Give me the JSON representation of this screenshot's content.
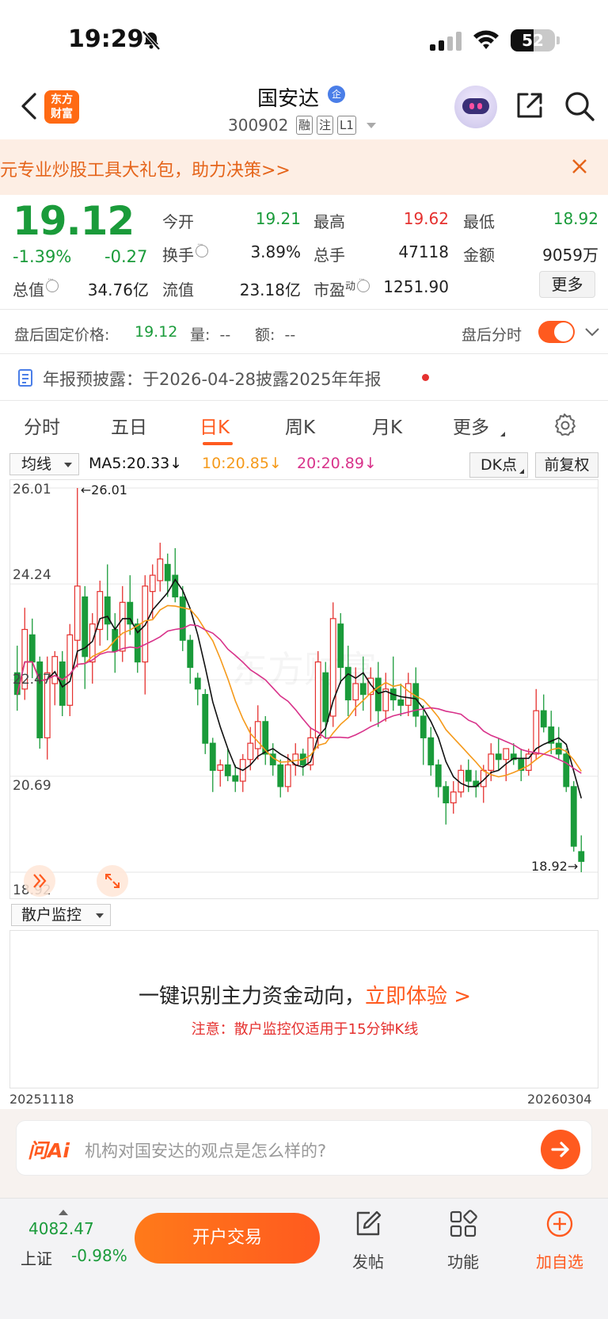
{
  "status_bar": {
    "time": "19:29",
    "battery": "52"
  },
  "header": {
    "logo": "东方财富",
    "logo_line1": "东方",
    "logo_line2": "财富",
    "stock_name": "国安达",
    "badge": "企",
    "stock_code": "300902",
    "tags": [
      "融",
      "注",
      "L1"
    ]
  },
  "promo": {
    "text": "元专业炒股工具大礼包，助力决策>>"
  },
  "quote": {
    "price": "19.12",
    "change_pct": "-1.39%",
    "change_amt": "-0.27",
    "open_label": "今开",
    "open": "19.21",
    "high_label": "最高",
    "high": "19.62",
    "low_label": "最低",
    "low": "18.92",
    "turnover_label": "换手",
    "turnover": "3.89%",
    "volume_label": "总手",
    "volume": "47118",
    "amount_label": "金额",
    "amount": "9059万",
    "mktcap_label": "总值",
    "mktcap": "34.76亿",
    "float_label": "流值",
    "float_cap": "23.18亿",
    "pe_label": "市盈",
    "pe_sup": "动",
    "pe": "1251.90",
    "more": "更多"
  },
  "after_hours": {
    "label": "盘后固定价格:",
    "price": "19.12",
    "volume_label": "量:",
    "volume": "--",
    "amount_label": "额:",
    "amount": "--",
    "toggle_label": "盘后分时",
    "toggle_on": true
  },
  "notice": {
    "text": "年报预披露：于2026-04-28披露2025年年报"
  },
  "tabs": [
    {
      "label": "分时"
    },
    {
      "label": "五日"
    },
    {
      "label": "日K"
    },
    {
      "label": "周K"
    },
    {
      "label": "月K"
    },
    {
      "label": "更多"
    }
  ],
  "ma_bar": {
    "select": "均线",
    "ma5": "MA5:20.33",
    "ma10": "10:20.85",
    "ma20": "20:20.89",
    "arrow": "↓",
    "dk": "DK点",
    "adjust": "前复权",
    "ma5_color": "#111111",
    "ma10_color": "#f59a1b",
    "ma20_color": "#d8328a"
  },
  "chart_data": {
    "type": "candlestick",
    "y_ticks": [
      "26.01",
      "24.24",
      "22.47",
      "20.69",
      "18.92"
    ],
    "ylim": [
      18.92,
      26.01
    ],
    "max_label": "←26.01",
    "min_label": "18.92→",
    "watermark": "东方财富",
    "x_start": "20251118",
    "x_end": "20260304",
    "up_color": "#e5312f",
    "down_color": "#1a9b3a",
    "candles": [
      [
        22.6,
        23.1,
        21.9,
        22.2
      ],
      [
        22.3,
        23.8,
        22.1,
        23.4
      ],
      [
        23.3,
        23.6,
        22.5,
        22.8
      ],
      [
        22.8,
        22.9,
        21.2,
        21.4
      ],
      [
        21.4,
        22.9,
        21.0,
        22.6
      ],
      [
        22.4,
        23.0,
        22.0,
        22.9
      ],
      [
        22.8,
        23.0,
        21.8,
        22.0
      ],
      [
        22.0,
        23.5,
        21.8,
        23.3
      ],
      [
        23.2,
        26.01,
        22.7,
        24.2
      ],
      [
        24.0,
        24.2,
        22.3,
        22.9
      ],
      [
        22.8,
        23.7,
        22.4,
        23.5
      ],
      [
        23.4,
        24.3,
        23.1,
        24.1
      ],
      [
        24.0,
        24.6,
        23.2,
        23.5
      ],
      [
        23.4,
        23.7,
        22.6,
        23.0
      ],
      [
        23.0,
        24.2,
        22.8,
        23.9
      ],
      [
        23.9,
        24.4,
        23.3,
        23.5
      ],
      [
        23.5,
        23.6,
        22.6,
        22.8
      ],
      [
        22.8,
        24.4,
        22.2,
        24.2
      ],
      [
        24.1,
        24.6,
        23.6,
        24.4
      ],
      [
        24.3,
        25.0,
        24.1,
        24.7
      ],
      [
        24.6,
        24.8,
        24.0,
        24.3
      ],
      [
        24.4,
        24.9,
        23.9,
        24.0
      ],
      [
        24.0,
        24.2,
        23.0,
        23.2
      ],
      [
        23.2,
        23.3,
        22.4,
        22.7
      ],
      [
        22.5,
        22.6,
        22.0,
        22.3
      ],
      [
        22.2,
        22.3,
        21.1,
        21.3
      ],
      [
        21.3,
        21.4,
        20.4,
        20.8
      ],
      [
        20.8,
        21.0,
        20.5,
        20.9
      ],
      [
        20.9,
        21.2,
        20.6,
        20.7
      ],
      [
        20.7,
        20.9,
        20.4,
        20.6
      ],
      [
        20.6,
        21.1,
        20.4,
        21.0
      ],
      [
        21.0,
        21.6,
        20.8,
        21.3
      ],
      [
        21.2,
        22.0,
        21.0,
        21.7
      ],
      [
        21.7,
        21.8,
        20.9,
        21.1
      ],
      [
        21.1,
        21.3,
        20.7,
        20.9
      ],
      [
        20.9,
        21.0,
        20.3,
        20.5
      ],
      [
        20.5,
        21.1,
        20.4,
        20.9
      ],
      [
        20.9,
        21.3,
        20.7,
        21.1
      ],
      [
        21.1,
        21.2,
        20.7,
        20.9
      ],
      [
        20.9,
        21.6,
        20.8,
        21.4
      ],
      [
        21.4,
        23.0,
        21.2,
        22.8
      ],
      [
        22.6,
        22.8,
        21.4,
        21.7
      ],
      [
        21.8,
        23.9,
        21.6,
        23.6
      ],
      [
        23.5,
        23.7,
        22.4,
        22.7
      ],
      [
        22.7,
        23.1,
        21.8,
        22.1
      ],
      [
        22.1,
        22.7,
        21.8,
        22.4
      ],
      [
        22.4,
        22.9,
        21.9,
        22.2
      ],
      [
        22.2,
        22.7,
        21.7,
        22.5
      ],
      [
        22.5,
        22.8,
        21.6,
        21.9
      ],
      [
        21.9,
        22.6,
        21.7,
        22.3
      ],
      [
        22.3,
        22.9,
        21.9,
        22.1
      ],
      [
        22.1,
        22.4,
        21.8,
        22.0
      ],
      [
        22.0,
        22.6,
        21.8,
        22.4
      ],
      [
        22.4,
        22.7,
        21.6,
        21.8
      ],
      [
        21.8,
        22.0,
        20.9,
        21.4
      ],
      [
        21.4,
        21.6,
        20.7,
        20.9
      ],
      [
        20.9,
        21.0,
        20.3,
        20.5
      ],
      [
        20.5,
        20.6,
        19.8,
        20.2
      ],
      [
        20.2,
        20.6,
        20.0,
        20.4
      ],
      [
        20.4,
        20.9,
        20.3,
        20.8
      ],
      [
        20.8,
        21.0,
        20.4,
        20.6
      ],
      [
        20.6,
        20.8,
        20.3,
        20.5
      ],
      [
        20.5,
        20.9,
        20.2,
        20.8
      ],
      [
        20.8,
        21.3,
        20.6,
        21.1
      ],
      [
        21.1,
        21.4,
        20.8,
        21.0
      ],
      [
        21.0,
        21.2,
        20.6,
        21.2
      ],
      [
        21.1,
        21.3,
        20.9,
        21.0
      ],
      [
        21.0,
        21.2,
        20.6,
        20.8
      ],
      [
        20.8,
        21.2,
        20.7,
        21.1
      ],
      [
        21.1,
        22.3,
        21.0,
        21.9
      ],
      [
        21.9,
        22.2,
        21.5,
        21.6
      ],
      [
        21.6,
        21.9,
        21.1,
        21.3
      ],
      [
        21.3,
        21.6,
        21.0,
        21.1
      ],
      [
        21.1,
        21.2,
        20.4,
        20.5
      ],
      [
        20.5,
        20.6,
        19.3,
        19.4
      ],
      [
        19.3,
        19.6,
        18.92,
        19.12
      ]
    ]
  },
  "monitor": {
    "select": "散户监控",
    "headline": "一键识别主力资金动向，",
    "cta": "立即体验 >",
    "note": "注意：散户监控仅适用于15分钟K线"
  },
  "ask_ai": {
    "logo": "问Ai",
    "placeholder": "机构对国安达的观点是怎么样的?"
  },
  "bottom_bar": {
    "index_value": "4082.47",
    "index_name": "上证",
    "index_change": "-0.98%",
    "open_account": "开户交易",
    "post": "发帖",
    "functions": "功能",
    "add_watch": "加自选"
  }
}
